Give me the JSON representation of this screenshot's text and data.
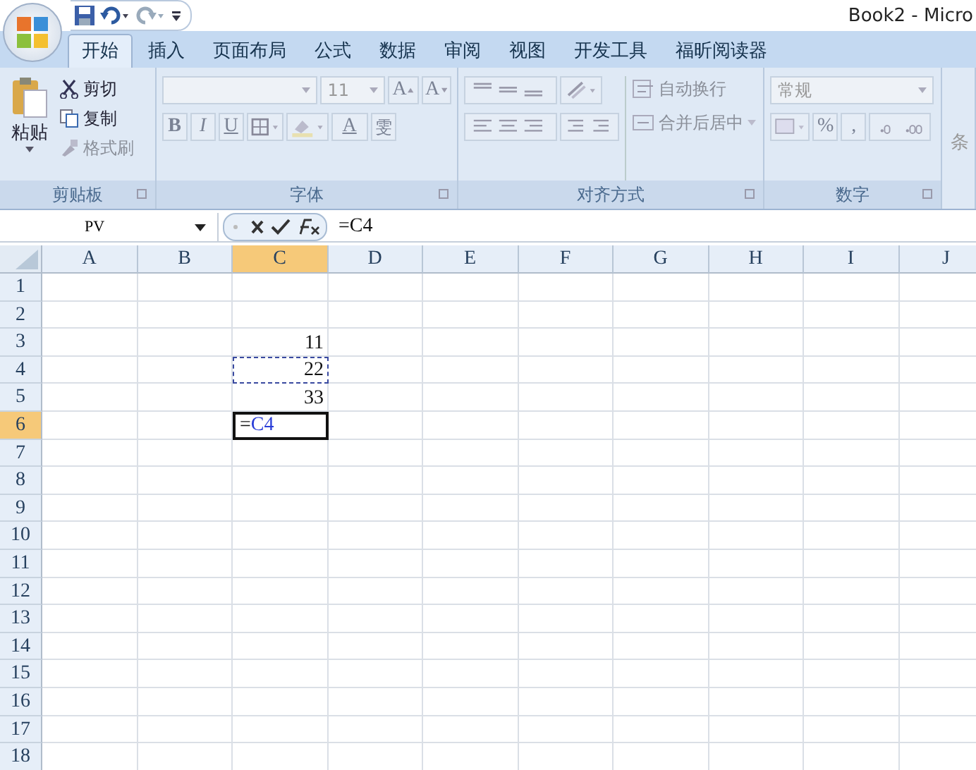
{
  "window": {
    "title": "Book2 - Micro"
  },
  "tabs": [
    {
      "label": "开始",
      "selected": true
    },
    {
      "label": "插入",
      "selected": false
    },
    {
      "label": "页面布局",
      "selected": false
    },
    {
      "label": "公式",
      "selected": false
    },
    {
      "label": "数据",
      "selected": false
    },
    {
      "label": "审阅",
      "selected": false
    },
    {
      "label": "视图",
      "selected": false
    },
    {
      "label": "开发工具",
      "selected": false
    },
    {
      "label": "福昕阅读器",
      "selected": false
    }
  ],
  "ribbon": {
    "disabled": true,
    "clipboard": {
      "paste": "粘贴",
      "cut": "剪切",
      "copy": "复制",
      "format_painter": "格式刷",
      "label": "剪贴板"
    },
    "font": {
      "size": "11",
      "grow": "A",
      "shrink": "A",
      "bold": "B",
      "italic": "I",
      "underline": "U",
      "font_color": "A",
      "phonetic": "雯",
      "label": "字体"
    },
    "alignment": {
      "wrap_text": "自动换行",
      "merge_center": "合并后居中",
      "label": "对齐方式"
    },
    "number": {
      "format": "常规",
      "percent": "%",
      "comma": ",",
      "label": "数字"
    },
    "next_group": {
      "label": "条"
    }
  },
  "formula_bar": {
    "name_box": "PV",
    "formula": "=C4"
  },
  "sheet": {
    "columns": [
      {
        "label": "A",
        "selected": false
      },
      {
        "label": "B",
        "selected": false
      },
      {
        "label": "C",
        "selected": true
      },
      {
        "label": "D",
        "selected": false
      },
      {
        "label": "E",
        "selected": false
      },
      {
        "label": "F",
        "selected": false
      },
      {
        "label": "G",
        "selected": false
      },
      {
        "label": "H",
        "selected": false
      },
      {
        "label": "I",
        "selected": false
      },
      {
        "label": "J",
        "selected": false
      }
    ],
    "rows": [
      {
        "label": "1",
        "selected": false,
        "cells": {}
      },
      {
        "label": "2",
        "selected": false,
        "cells": {}
      },
      {
        "label": "3",
        "selected": false,
        "cells": {
          "C": {
            "kind": "number",
            "text": "11"
          }
        }
      },
      {
        "label": "4",
        "selected": false,
        "cells": {
          "C": {
            "kind": "number",
            "text": "22",
            "copy_marquee": true
          }
        }
      },
      {
        "label": "5",
        "selected": false,
        "cells": {
          "C": {
            "kind": "number",
            "text": "33"
          }
        }
      },
      {
        "label": "6",
        "selected": true,
        "cells": {
          "C": {
            "kind": "editing",
            "parts": [
              {
                "kind": "operator",
                "text": "="
              },
              {
                "kind": "reference",
                "text": "C4"
              }
            ]
          }
        }
      },
      {
        "label": "7",
        "selected": false,
        "cells": {}
      },
      {
        "label": "8",
        "selected": false,
        "cells": {}
      },
      {
        "label": "9",
        "selected": false,
        "cells": {}
      },
      {
        "label": "10",
        "selected": false,
        "cells": {}
      },
      {
        "label": "11",
        "selected": false,
        "cells": {}
      },
      {
        "label": "12",
        "selected": false,
        "cells": {}
      },
      {
        "label": "13",
        "selected": false,
        "cells": {}
      },
      {
        "label": "14",
        "selected": false,
        "cells": {}
      },
      {
        "label": "15",
        "selected": false,
        "cells": {}
      },
      {
        "label": "16",
        "selected": false,
        "cells": {}
      },
      {
        "label": "17",
        "selected": false,
        "cells": {}
      },
      {
        "label": "18",
        "selected": false,
        "cells": {}
      }
    ]
  }
}
